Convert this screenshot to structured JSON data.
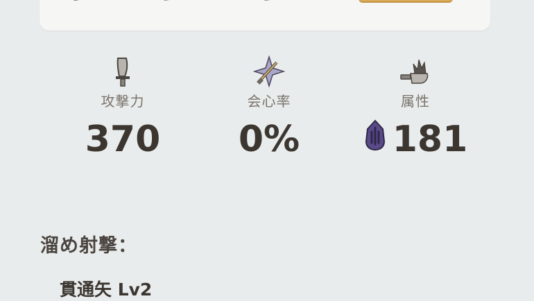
{
  "top_panel": {
    "items": [
      {
        "icon": "blade-icon"
      },
      {
        "icon": "blade-icon"
      },
      {
        "icon": "blade-icon"
      }
    ],
    "accent_color": "#d7aa58"
  },
  "stats": [
    {
      "icon": "attack-icon",
      "label": "攻撃力",
      "value": "370"
    },
    {
      "icon": "affinity-icon",
      "label": "会心率",
      "value": "0%"
    },
    {
      "icon": "element-icon",
      "label": "属性",
      "value": "181",
      "badge_icon": "dragon-element-icon"
    }
  ],
  "charge_shot": {
    "title": "溜め射撃：",
    "line": "貫通矢 Lv2"
  },
  "colors": {
    "background": "#e9ecec",
    "value_text": "#3c3631",
    "label_text": "#7a736c",
    "element_badge": "#5a4a8a"
  }
}
